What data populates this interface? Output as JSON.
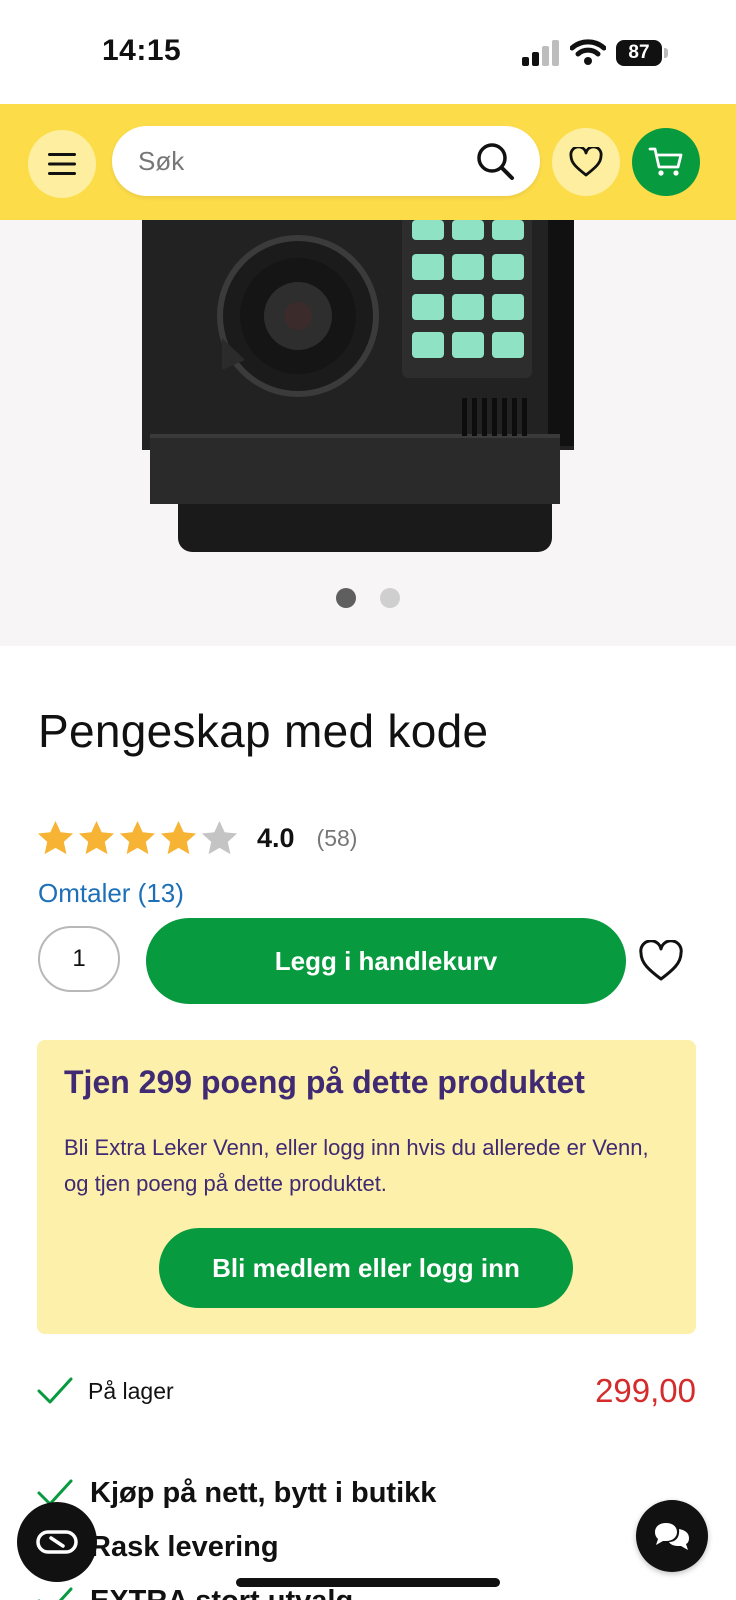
{
  "status_bar": {
    "time": "14:15",
    "battery": "87",
    "icons": [
      "cellular-signal-icon",
      "wifi-icon",
      "battery-icon"
    ]
  },
  "header": {
    "search_placeholder": "Søk",
    "icons": [
      "menu-icon",
      "search-icon",
      "heart-icon",
      "cart-icon"
    ],
    "colors": {
      "background": "#fddc4a",
      "cart_button": "#079a3e"
    }
  },
  "gallery": {
    "image_count": 2,
    "active_index": 0
  },
  "product": {
    "title": "Pengeskap med kode",
    "rating_value": "4.0",
    "rating_stars": 4,
    "rating_count": "(58)",
    "reviews_link": "Omtaler (13)",
    "quantity": "1",
    "add_to_cart": "Legg i handlekurv",
    "stock": "På lager",
    "price": "299,00"
  },
  "loyalty": {
    "title": "Tjen 299 poeng på dette produktet",
    "text": "Bli Extra Leker Venn, eller logg inn hvis du allerede er Venn, og tjen poeng på dette produktet.",
    "button": "Bli medlem eller logg inn"
  },
  "usps": [
    {
      "label": "Kjøp på nett, bytt i butikk"
    },
    {
      "label": "Rask levering"
    },
    {
      "label": "EXTRA stort utvalg"
    }
  ],
  "colors": {
    "primary_green": "#079a3e",
    "price_red": "#d42b2b",
    "star_gold": "#f7b334",
    "loyalty_bg": "#fdf0ab",
    "loyalty_text": "#3f2a73",
    "link_blue": "#1d6fb8"
  }
}
